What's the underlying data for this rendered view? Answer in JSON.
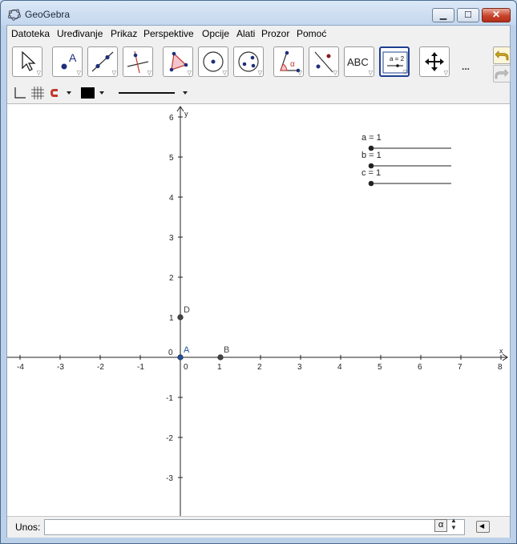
{
  "window": {
    "title": "GeoGebra"
  },
  "window_buttons": {
    "minimize": "▁",
    "maximize": "☐",
    "close": "✕"
  },
  "menu": [
    "Datoteka",
    "Uređivanje",
    "Prikaz",
    "Perspektive",
    "Opcije",
    "Alati",
    "Prozor",
    "Pomoć"
  ],
  "toolbar": {
    "tools": [
      {
        "name": "move-tool-icon"
      },
      {
        "name": "point-tool-icon"
      },
      {
        "name": "line-tool-icon"
      },
      {
        "name": "perpendicular-tool-icon"
      },
      {
        "name": "polygon-tool-icon"
      },
      {
        "name": "circle-tool-icon"
      },
      {
        "name": "conic-tool-icon"
      },
      {
        "name": "angle-tool-icon"
      },
      {
        "name": "reflect-tool-icon"
      },
      {
        "name": "text-tool-icon",
        "label": "ABC"
      },
      {
        "name": "slider-tool-icon",
        "label": "a = 2"
      },
      {
        "name": "move-graphics-tool-icon"
      }
    ],
    "more": "..."
  },
  "graphics": {
    "x_axis_label": "x",
    "y_axis_label": "y",
    "x_ticks": [
      "-4",
      "-3",
      "-2",
      "-1",
      "0",
      "1",
      "2",
      "3",
      "4",
      "5",
      "6",
      "7",
      "8"
    ],
    "y_ticks": [
      "6",
      "5",
      "4",
      "3",
      "2",
      "1",
      "-1",
      "-2",
      "-3"
    ],
    "origin_label": "0",
    "points": [
      {
        "label": "A",
        "x": 0,
        "y": 0,
        "color": "#1e4fa0"
      },
      {
        "label": "B",
        "x": 1,
        "y": 0,
        "color": "#444444"
      },
      {
        "label": "D",
        "x": 0,
        "y": 1,
        "color": "#444444"
      }
    ],
    "sliders": [
      {
        "label": "a = 1",
        "value": 1
      },
      {
        "label": "b = 1",
        "value": 1
      },
      {
        "label": "c = 1",
        "value": 1
      }
    ]
  },
  "input_bar": {
    "label": "Unos:",
    "value": "",
    "alpha_button": "α"
  },
  "colors": {
    "title_bar": "#c4d7ee",
    "active_tool_border": "#1d3f8f",
    "point_a": "#1e4fa0"
  }
}
